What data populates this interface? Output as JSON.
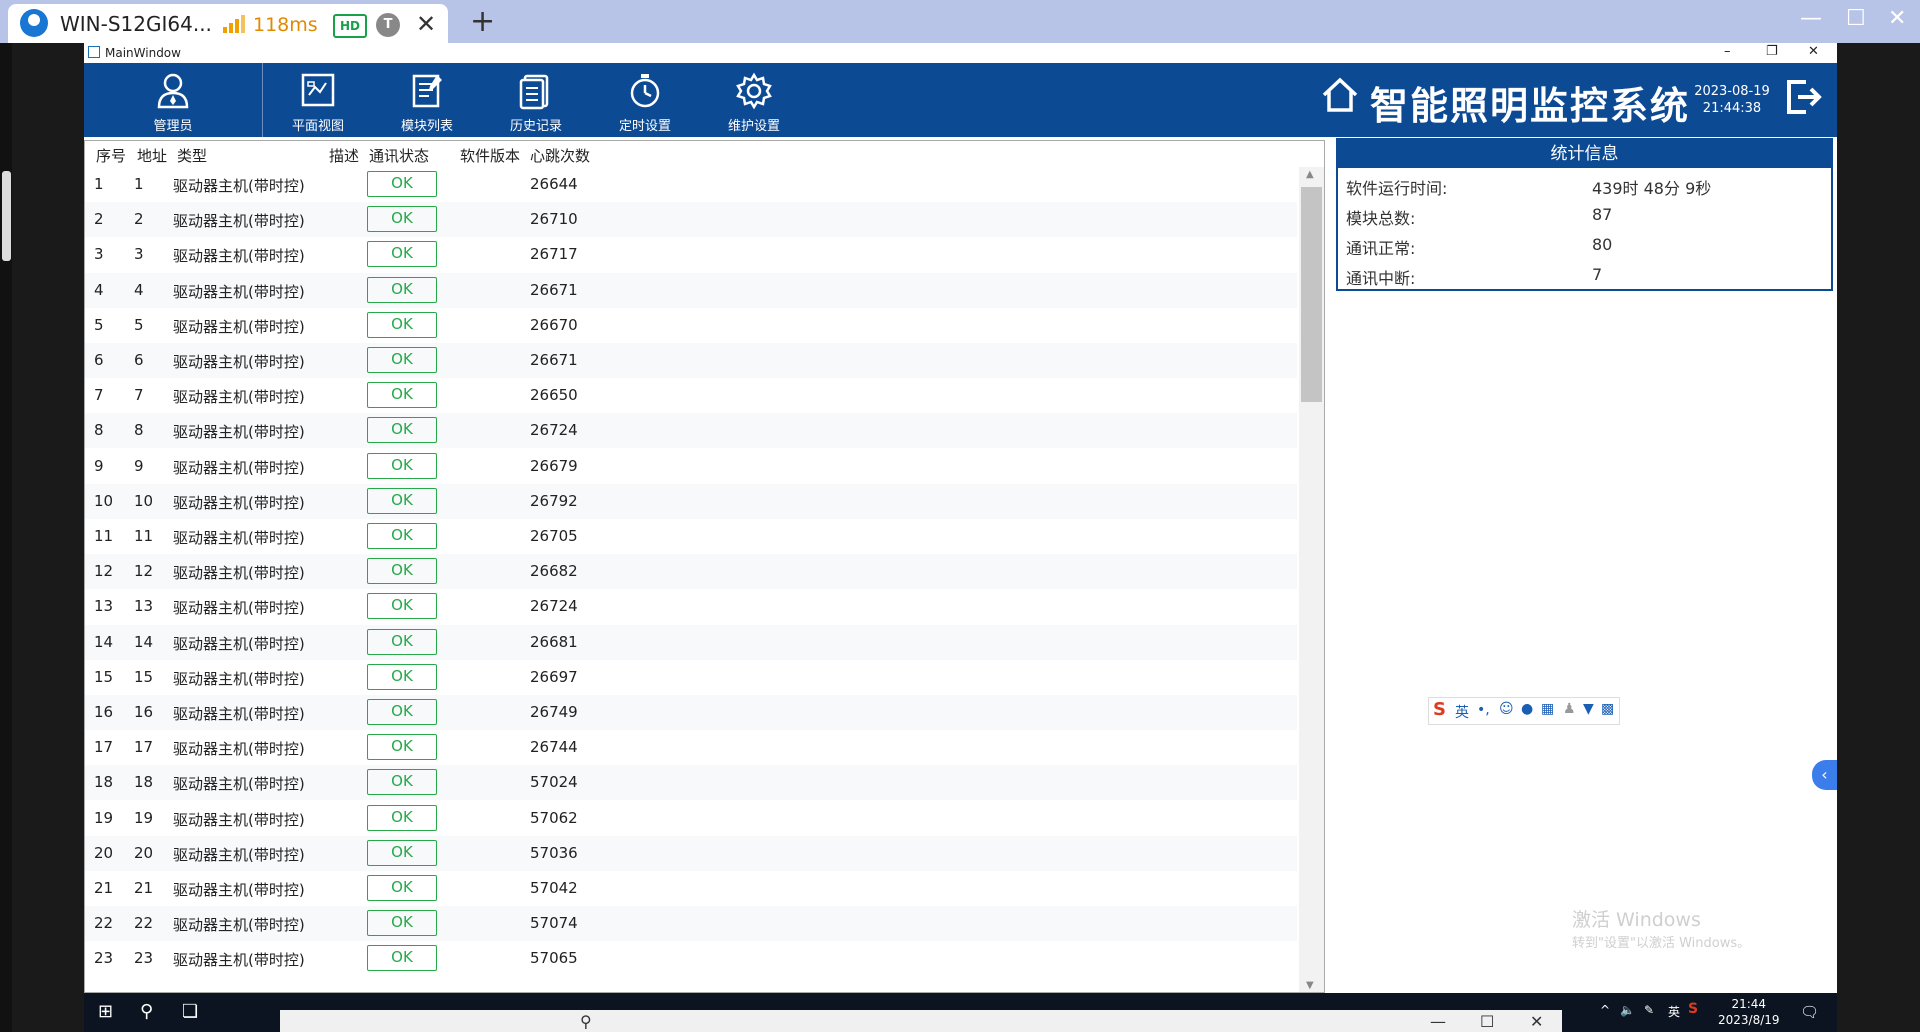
{
  "browser": {
    "tab_title": "WIN-S12GI64...",
    "latency": "118ms",
    "hd_badge": "HD",
    "user_badge": "T",
    "close_tab": "✕",
    "new_tab": "+"
  },
  "window": {
    "title": "MainWindow"
  },
  "toolbar": {
    "items": [
      {
        "label": "管理员",
        "icon": "admin-user-icon"
      },
      {
        "label": "平面视图",
        "icon": "floor-plan-icon"
      },
      {
        "label": "模块列表",
        "icon": "module-list-icon"
      },
      {
        "label": "历史记录",
        "icon": "history-record-icon"
      },
      {
        "label": "定时设置",
        "icon": "timer-icon"
      },
      {
        "label": "维护设置",
        "icon": "gear-icon"
      }
    ],
    "system_title": "智能照明监控系统",
    "date": "2023-08-19",
    "time": "21:44:38"
  },
  "grid": {
    "columns": [
      "序号",
      "地址",
      "类型",
      "描述",
      "通讯状态",
      "软件版本",
      "心跳次数"
    ],
    "rows": [
      {
        "index": "1",
        "address": "1",
        "type": "驱动器主机(带时控)",
        "status": "OK",
        "heartbeat": "26644"
      },
      {
        "index": "2",
        "address": "2",
        "type": "驱动器主机(带时控)",
        "status": "OK",
        "heartbeat": "26710"
      },
      {
        "index": "3",
        "address": "3",
        "type": "驱动器主机(带时控)",
        "status": "OK",
        "heartbeat": "26717"
      },
      {
        "index": "4",
        "address": "4",
        "type": "驱动器主机(带时控)",
        "status": "OK",
        "heartbeat": "26671"
      },
      {
        "index": "5",
        "address": "5",
        "type": "驱动器主机(带时控)",
        "status": "OK",
        "heartbeat": "26670"
      },
      {
        "index": "6",
        "address": "6",
        "type": "驱动器主机(带时控)",
        "status": "OK",
        "heartbeat": "26671"
      },
      {
        "index": "7",
        "address": "7",
        "type": "驱动器主机(带时控)",
        "status": "OK",
        "heartbeat": "26650"
      },
      {
        "index": "8",
        "address": "8",
        "type": "驱动器主机(带时控)",
        "status": "OK",
        "heartbeat": "26724"
      },
      {
        "index": "9",
        "address": "9",
        "type": "驱动器主机(带时控)",
        "status": "OK",
        "heartbeat": "26679"
      },
      {
        "index": "10",
        "address": "10",
        "type": "驱动器主机(带时控)",
        "status": "OK",
        "heartbeat": "26792"
      },
      {
        "index": "11",
        "address": "11",
        "type": "驱动器主机(带时控)",
        "status": "OK",
        "heartbeat": "26705"
      },
      {
        "index": "12",
        "address": "12",
        "type": "驱动器主机(带时控)",
        "status": "OK",
        "heartbeat": "26682"
      },
      {
        "index": "13",
        "address": "13",
        "type": "驱动器主机(带时控)",
        "status": "OK",
        "heartbeat": "26724"
      },
      {
        "index": "14",
        "address": "14",
        "type": "驱动器主机(带时控)",
        "status": "OK",
        "heartbeat": "26681"
      },
      {
        "index": "15",
        "address": "15",
        "type": "驱动器主机(带时控)",
        "status": "OK",
        "heartbeat": "26697"
      },
      {
        "index": "16",
        "address": "16",
        "type": "驱动器主机(带时控)",
        "status": "OK",
        "heartbeat": "26749"
      },
      {
        "index": "17",
        "address": "17",
        "type": "驱动器主机(带时控)",
        "status": "OK",
        "heartbeat": "26744"
      },
      {
        "index": "18",
        "address": "18",
        "type": "驱动器主机(带时控)",
        "status": "OK",
        "heartbeat": "57024"
      },
      {
        "index": "19",
        "address": "19",
        "type": "驱动器主机(带时控)",
        "status": "OK",
        "heartbeat": "57062"
      },
      {
        "index": "20",
        "address": "20",
        "type": "驱动器主机(带时控)",
        "status": "OK",
        "heartbeat": "57036"
      },
      {
        "index": "21",
        "address": "21",
        "type": "驱动器主机(带时控)",
        "status": "OK",
        "heartbeat": "57042"
      },
      {
        "index": "22",
        "address": "22",
        "type": "驱动器主机(带时控)",
        "status": "OK",
        "heartbeat": "57074"
      },
      {
        "index": "23",
        "address": "23",
        "type": "驱动器主机(带时控)",
        "status": "OK",
        "heartbeat": "57065"
      }
    ]
  },
  "stats": {
    "title": "统计信息",
    "items": [
      {
        "label": "软件运行时间:",
        "value": "439时 48分 9秒"
      },
      {
        "label": "模块总数:",
        "value": "87"
      },
      {
        "label": "通讯正常:",
        "value": "80"
      },
      {
        "label": "通讯中断:",
        "value": "7"
      }
    ]
  },
  "ime": {
    "lang": "英"
  },
  "watermark": {
    "line1": "激活 Windows",
    "line2": "转到\"设置\"以激活 Windows。"
  },
  "taskbar": {
    "lang": "英",
    "time": "21:44",
    "date": "2023/8/19"
  },
  "colors": {
    "header": "#0d4a94",
    "ok": "#27a94a",
    "browser_bar": "#b7c4e8"
  }
}
